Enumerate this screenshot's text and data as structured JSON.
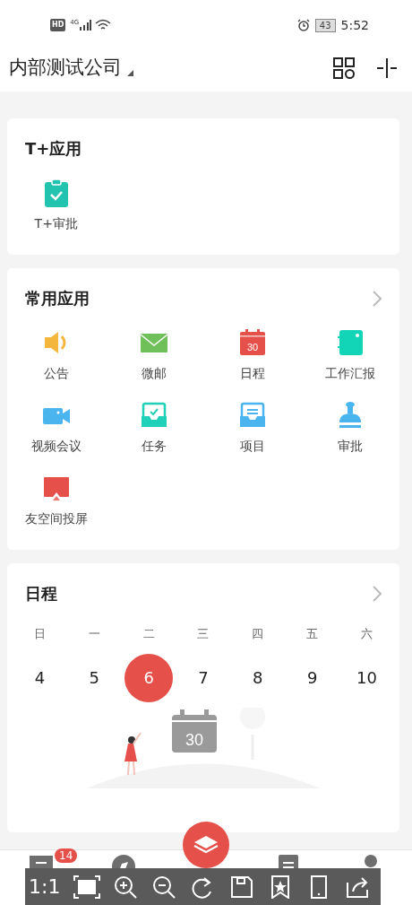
{
  "status_bar": {
    "hd": "HD",
    "network": "4G",
    "battery": "43",
    "time": "5:52"
  },
  "header": {
    "company": "内部测试公司"
  },
  "sections": [
    {
      "title": "T+应用",
      "has_more": false,
      "apps": [
        {
          "label": "T+审批",
          "kind": "clipboard"
        }
      ]
    },
    {
      "title": "常用应用",
      "has_more": true,
      "apps": [
        {
          "label": "公告",
          "kind": "megaphone"
        },
        {
          "label": "微邮",
          "kind": "mail"
        },
        {
          "label": "日程",
          "kind": "calendar",
          "icon_text": "30"
        },
        {
          "label": "工作汇报",
          "kind": "notebook"
        },
        {
          "label": "视频会议",
          "kind": "video"
        },
        {
          "label": "任务",
          "kind": "task"
        },
        {
          "label": "项目",
          "kind": "project"
        },
        {
          "label": "审批",
          "kind": "stamp"
        },
        {
          "label": "友空间投屏",
          "kind": "cast"
        }
      ]
    }
  ],
  "schedule": {
    "title": "日程",
    "has_more": true,
    "weekdays": [
      "日",
      "一",
      "二",
      "三",
      "四",
      "五",
      "六"
    ],
    "days": [
      {
        "label": "4",
        "selected": false
      },
      {
        "label": "5",
        "selected": false
      },
      {
        "label": "6",
        "selected": true
      },
      {
        "label": "7",
        "selected": false
      },
      {
        "label": "8",
        "selected": false
      },
      {
        "label": "9",
        "selected": false
      },
      {
        "label": "10",
        "selected": false
      }
    ],
    "illustration_label": "30"
  },
  "tab_bar": [
    {
      "kind": "chat",
      "badge": "14",
      "selected": false
    },
    {
      "kind": "compass",
      "selected": false
    },
    {
      "kind": "layers",
      "selected": true
    },
    {
      "kind": "contacts",
      "selected": false
    },
    {
      "kind": "person",
      "selected": false
    }
  ],
  "viewer_toolbar": {
    "ratio": "1:1"
  }
}
